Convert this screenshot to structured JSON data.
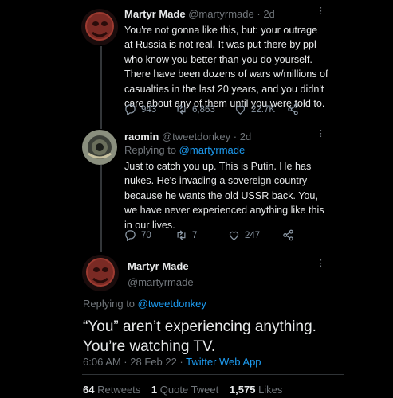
{
  "tweet1": {
    "name": "Martyr Made",
    "handle": "@martyrmade",
    "time": "· 2d",
    "lines": [
      "You're not gonna like this, but: your outrage",
      "at Russia is not real. It was put there by ppl",
      "who know you better than you do yourself.",
      "There have been dozens of wars w/millions of",
      "casualties in the last 20 years, and you didn't",
      "care about any of them until you were told to."
    ],
    "replies": "943",
    "retweets": "6,863",
    "likes": "22.7K"
  },
  "tweet2": {
    "name": "raomin",
    "handle": "@tweetdonkey",
    "time": "· 2d",
    "replying_prefix": "Replying to",
    "replying_to": "@martyrmade",
    "lines": [
      "Just to catch you up. This is Putin. He has",
      "nukes. He's invading a sovereign country",
      "because he wants the old USSR back. You,",
      "we have never experienced anything like this",
      "in our lives."
    ],
    "replies": "70",
    "retweets": "7",
    "likes": "247"
  },
  "main": {
    "name": "Martyr Made",
    "handle": "@martyrmade",
    "replying_prefix": "Replying to",
    "replying_to": "@tweetdonkey",
    "line1": "“You” aren’t experiencing anything.",
    "line2": "You’re watching TV.",
    "timestamp": "6:06 AM · 28 Feb 22 ·",
    "source": "Twitter Web App",
    "retweets_count": "64",
    "retweets_label": "Retweets",
    "quotes_count": "1",
    "quotes_label": "Quote Tweet",
    "likes_count": "1,575",
    "likes_label": "Likes"
  },
  "icons": {
    "reply": "reply-icon",
    "retweet": "retweet-icon",
    "like": "heart-icon",
    "share": "share-icon",
    "more": "more-dots-icon"
  },
  "colors": {
    "background": "#000000",
    "text": "#e7e9ea",
    "muted": "#71767b",
    "link": "#1d9bf0"
  }
}
